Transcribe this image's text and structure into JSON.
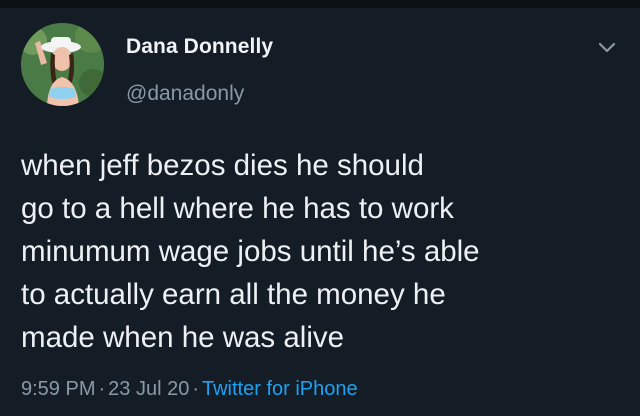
{
  "tweet": {
    "author": {
      "display_name": "Dana Donnelly",
      "handle": "@danadonly",
      "avatar_icon": "profile-photo"
    },
    "text_lines": [
      "when jeff bezos dies he should",
      "go to a hell where he has to work",
      "minumum wage jobs until he’s able",
      "to actually earn all the money he",
      "made when he was alive"
    ],
    "time": "9:59 PM",
    "date": "23 Jul 20",
    "separator": "·",
    "source": "Twitter for iPhone",
    "menu_icon": "chevron-down-icon"
  },
  "colors": {
    "background": "#141d26",
    "text": "#eef1f4",
    "muted": "#8899a6",
    "link": "#1da1f2"
  }
}
